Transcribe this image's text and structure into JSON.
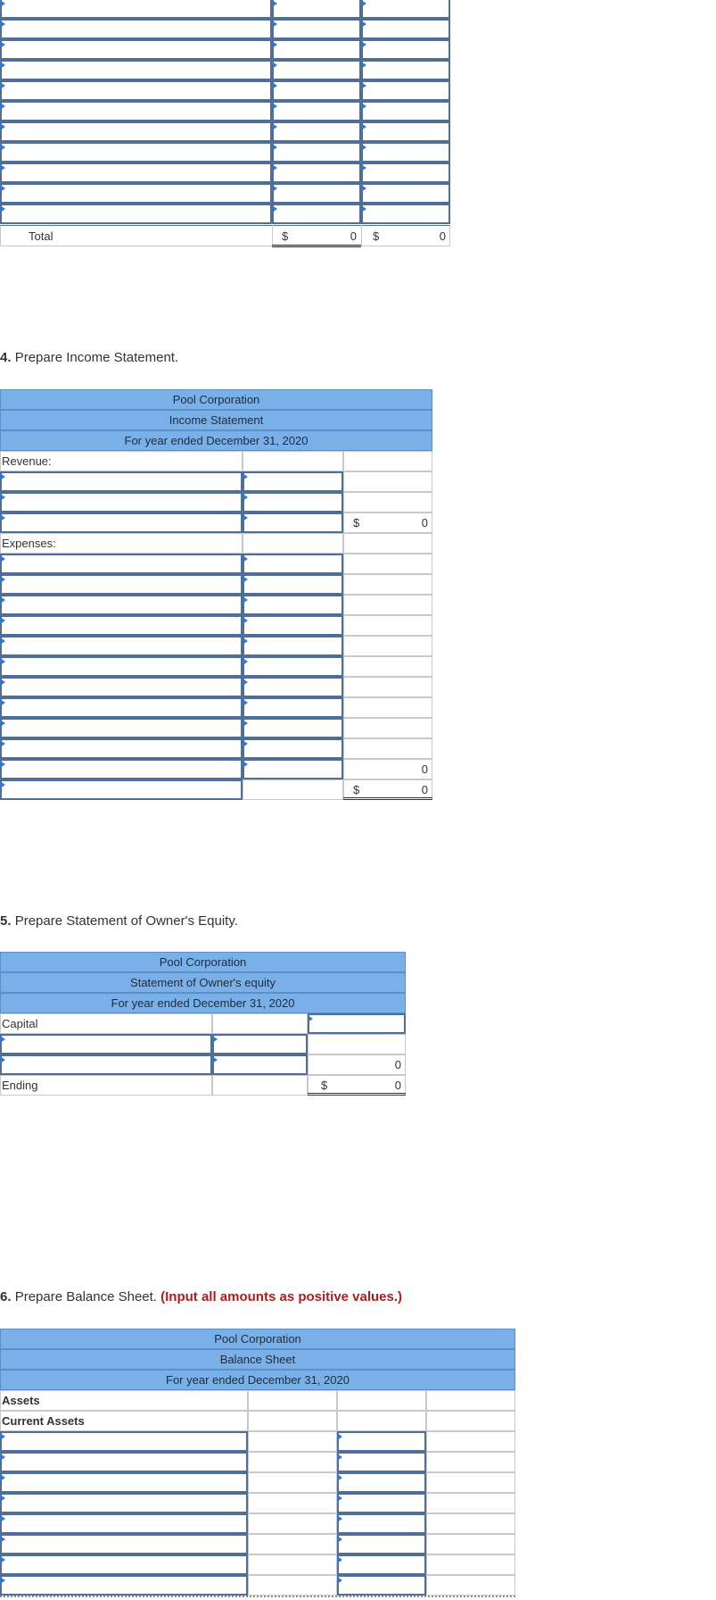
{
  "journal_table": {
    "total_label": "Total",
    "debit_currency": "$",
    "debit_total": "0",
    "credit_currency": "$",
    "credit_total": "0"
  },
  "income_statement": {
    "heading_number": "4.",
    "heading_text": "Prepare Income Statement.",
    "company": "Pool Corporation",
    "title": "Income Statement",
    "period": "For year ended December 31, 2020",
    "revenue_label": "Revenue:",
    "revenue_currency": "$",
    "revenue_total": "0",
    "expenses_label": "Expenses:",
    "expenses_total": "0",
    "net_currency": "$",
    "net_total": "0"
  },
  "owners_equity": {
    "heading_number": "5.",
    "heading_text": "Prepare Statement of Owner's Equity.",
    "company": "Pool Corporation",
    "title": "Statement of Owner's equity",
    "period": "For year ended December 31, 2020",
    "capital_label": "Capital",
    "subtotal": "0",
    "ending_label": "Ending",
    "ending_currency": "$",
    "ending_total": "0"
  },
  "balance_sheet": {
    "heading_number": "6.",
    "heading_text": "Prepare Balance Sheet.",
    "heading_note": "(Input all amounts as positive values.)",
    "company": "Pool Corporation",
    "title": "Balance Sheet",
    "period": "For year ended December 31, 2020",
    "assets_label": "Assets",
    "current_assets_label": "Current Assets"
  },
  "colors": {
    "header_fill": "#7ab0e8",
    "input_border": "#4f6f99",
    "marker": "#3a76c4",
    "note_red": "#b01d1d"
  }
}
